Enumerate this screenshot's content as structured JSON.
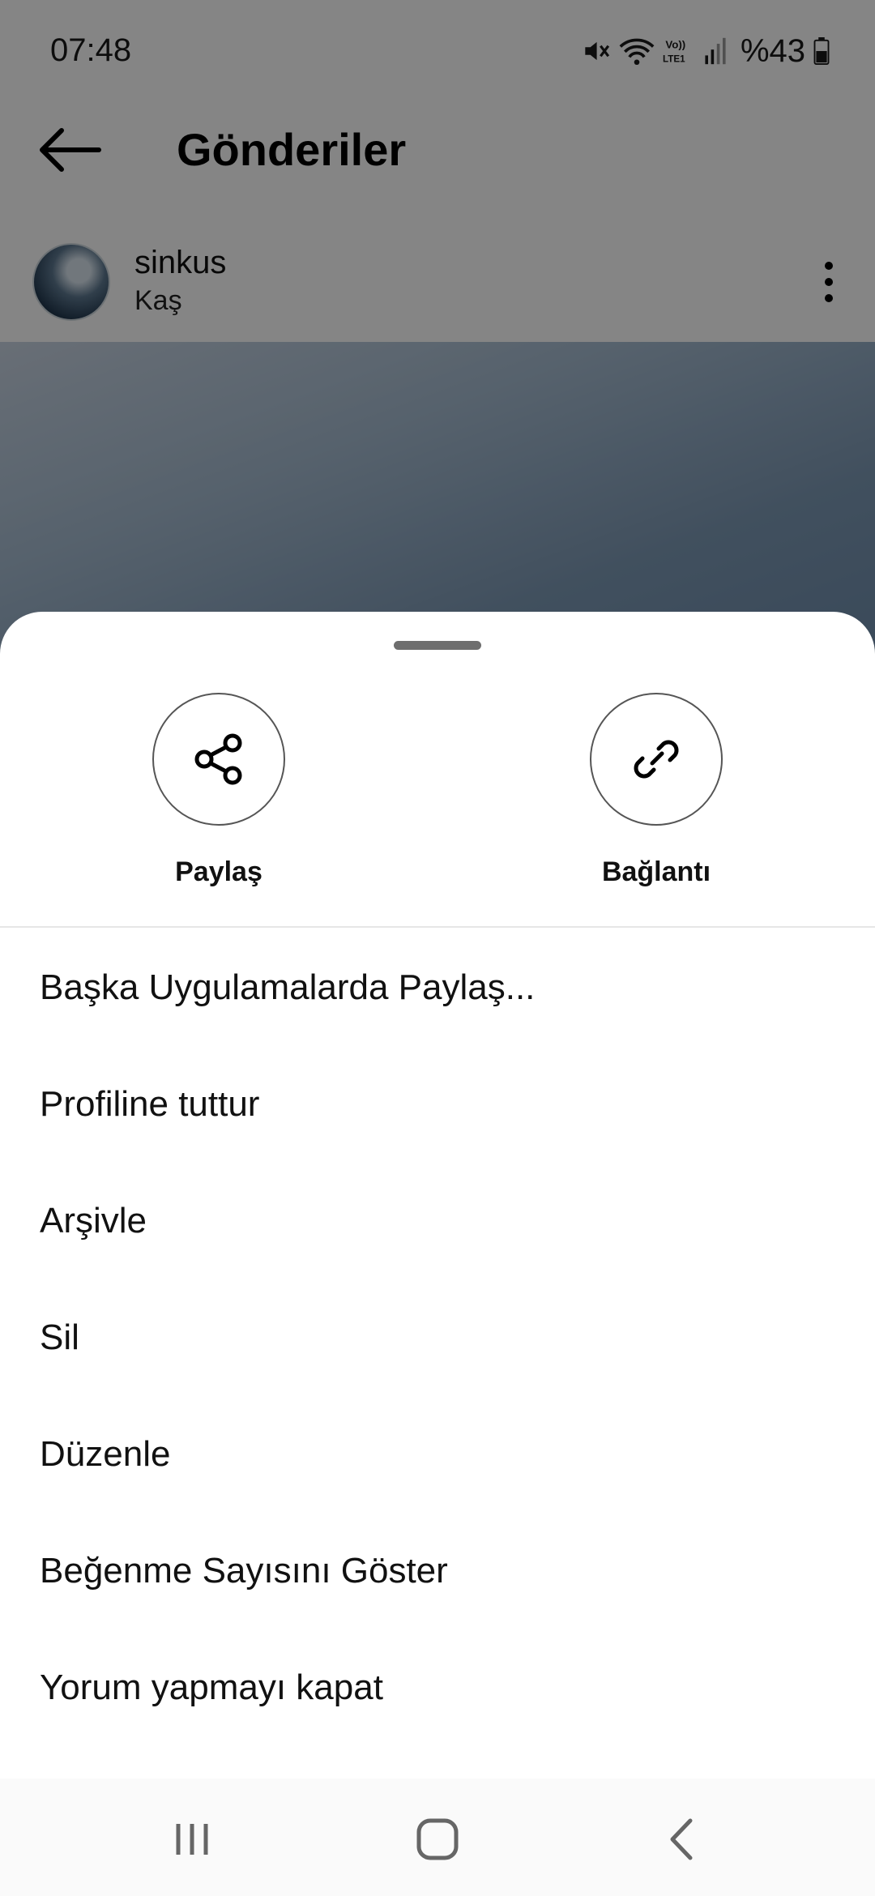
{
  "status_bar": {
    "time": "07:48",
    "battery": "%43",
    "icons": [
      "mute-icon",
      "wifi-icon",
      "volte-lte-icon",
      "signal-icon",
      "battery-icon"
    ]
  },
  "header": {
    "title": "Gönderiler",
    "back_icon": "arrow-left-icon"
  },
  "post": {
    "username": "sinkus",
    "location": "Kaş",
    "more_icon": "more-vertical-icon"
  },
  "sheet": {
    "actions": [
      {
        "label": "Paylaş",
        "icon": "share-icon"
      },
      {
        "label": "Bağlantı",
        "icon": "link-icon"
      }
    ],
    "menu_items": [
      "Başka Uygulamalarda Paylaş...",
      "Profiline tuttur",
      "Arşivle",
      "Sil",
      "Düzenle",
      "Beğenme Sayısını Göster",
      "Yorum yapmayı kapat"
    ]
  },
  "navbar": {
    "buttons": [
      "recent-apps-icon",
      "home-icon",
      "back-icon"
    ]
  },
  "colors": {
    "scrim": "#00000080",
    "sheet_background": "#ffffff",
    "text": "#111111"
  }
}
